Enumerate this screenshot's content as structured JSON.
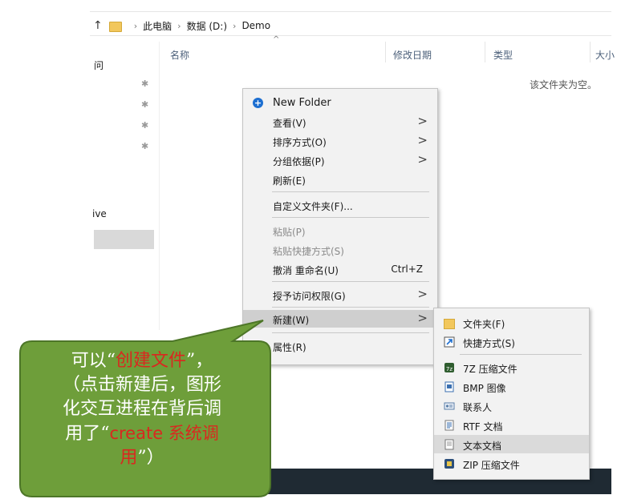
{
  "address_bar": {
    "up_arrow": "↑",
    "crumbs": [
      "此电脑",
      "数据 (D:)",
      "Demo"
    ],
    "separator": "›"
  },
  "headers": {
    "name": "名称",
    "date": "修改日期",
    "type": "类型",
    "size": "大小",
    "sort_arrow": "^"
  },
  "empty_message": "该文件夹为空。",
  "nav": {
    "quick_access": "问",
    "onedrive": "ive",
    "pin": "📌"
  },
  "context_menu": {
    "new_folder": "New Folder",
    "view": "查看(V)",
    "sort_by": "排序方式(O)",
    "group_by": "分组依据(P)",
    "refresh": "刷新(E)",
    "customize": "自定义文件夹(F)...",
    "paste": "粘贴(P)",
    "paste_shortcut": "粘贴快捷方式(S)",
    "undo_rename": "撤消 重命名(U)",
    "undo_shortcut": "Ctrl+Z",
    "give_access": "授予访问权限(G)",
    "new": "新建(W)",
    "properties": "属性(R)",
    "arrow": ">"
  },
  "submenu": {
    "folder": "文件夹(F)",
    "shortcut": "快捷方式(S)",
    "7z": "7Z 压缩文件",
    "bmp": "BMP 图像",
    "contact": "联系人",
    "rtf": "RTF 文档",
    "text": "文本文档",
    "zip": "ZIP 压缩文件"
  },
  "callout": {
    "line1_prefix": "可以“",
    "line1_red": "创建文件",
    "line1_suffix": "”，",
    "line2": "（点击新建后，图形",
    "line3": "化交互进程在背后调",
    "line4_prefix": "用了“",
    "line4_red": "create 系统调",
    "line5_red": "用",
    "line5_suffix": "”）"
  },
  "colors": {
    "callout_fill": "#6e9e3a",
    "callout_stroke": "#4d7628",
    "highlight_text": "#d9281f"
  }
}
